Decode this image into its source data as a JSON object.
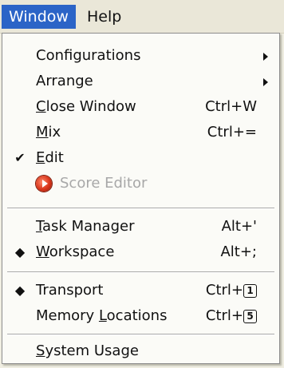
{
  "menubar": {
    "window_label": "Window",
    "help_label": "Help"
  },
  "menu": {
    "items": [
      {
        "label": "Configurations",
        "submenu": true
      },
      {
        "label": "Arrange",
        "submenu": true
      },
      {
        "label_prefix": "C",
        "label_rest": "lose Window",
        "shortcut": "Ctrl+W"
      },
      {
        "label_prefix": "M",
        "label_rest": "ix",
        "shortcut": "Ctrl+="
      },
      {
        "label_prefix": "E",
        "label_rest": "dit",
        "check": "✔"
      },
      {
        "label": "Score Editor",
        "disabled": true,
        "icon": "record-play-icon"
      },
      {
        "label_prefix": "T",
        "label_rest": "ask Manager",
        "shortcut": "Alt+'"
      },
      {
        "label_prefix": "W",
        "label_rest": "orkspace",
        "shortcut": "Alt+;",
        "check": "◆"
      },
      {
        "label": "Transport",
        "shortcut_prefix": "Ctrl+",
        "shortcut_key": "1",
        "check": "◆"
      },
      {
        "label_start": "Memory ",
        "label_prefix": "L",
        "label_rest": "ocations",
        "shortcut_prefix": "Ctrl+",
        "shortcut_key": "5"
      },
      {
        "label_prefix": "S",
        "label_rest": "ystem Usage"
      }
    ]
  }
}
